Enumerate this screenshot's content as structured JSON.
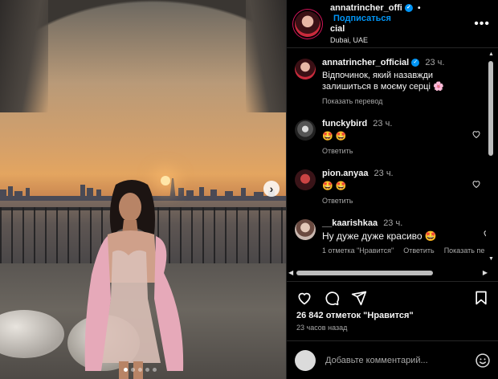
{
  "post": {
    "username": "annatrincher_official",
    "username_header_line1": "annatrincher_offi",
    "username_header_line2": "cial",
    "location": "Dubai, UAE",
    "follow_label": "Подписаться",
    "bullet": "•",
    "more_label": "•••",
    "caption": "Відпочинок, який назавжди залишиться в моєму серці 🌸",
    "caption_time": "23 ч.",
    "translate_label": "Показать перевод",
    "likes": "26 842 отметок \"Нравится\"",
    "posted_ago": "23 часов назад",
    "add_comment_placeholder": "Добавьте комментарий...",
    "carousel_dots": 5,
    "carousel_active": 0
  },
  "comments": [
    {
      "user": "funckybird",
      "time": "23 ч.",
      "text": "🤩 🤩",
      "reply": "Ответить"
    },
    {
      "user": "pion.anyaa",
      "time": "23 ч.",
      "text": "🤩 🤩",
      "reply": "Ответить"
    },
    {
      "user": "__kaarishkaa",
      "time": "23 ч.",
      "text": "Ну дуже дуже красиво 🤩",
      "likes": "1 отметка \"Нравится\"",
      "reply": "Ответить",
      "translate": "Показать пе"
    }
  ],
  "icons": [
    "heart-icon",
    "comment-icon",
    "share-icon",
    "bookmark-icon",
    "emoji-icon",
    "verified-icon",
    "chevron-right-icon"
  ],
  "colors": {
    "accent": "#0095f6",
    "background": "#000000",
    "secondary_text": "#a8a8a8"
  }
}
